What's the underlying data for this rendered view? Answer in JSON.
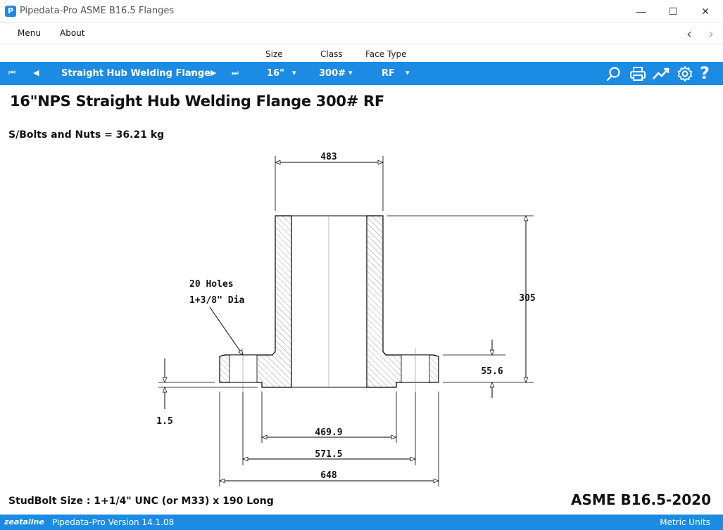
{
  "window": {
    "app_icon": "P",
    "title": "Pipedata-Pro  ASME B16.5 Flanges",
    "minimize": "—",
    "maximize": "☐",
    "close": "✕"
  },
  "menu": {
    "items": [
      "Menu",
      "About"
    ],
    "back": "‹",
    "forward": "›"
  },
  "selector_labels": {
    "size": "Size",
    "class": "Class",
    "face_type": "Face Type"
  },
  "toolbar": {
    "first": "⏮",
    "prev": "◀",
    "flange_type": "Straight Hub Welding Flange",
    "next": "▶",
    "last": "⏭",
    "size": "16\"",
    "class": "300#",
    "face": "RF",
    "dropdown": "▾",
    "icons": [
      "search-icon",
      "print-icon",
      "chart-icon",
      "gear-icon",
      "help-icon"
    ],
    "help_label": "?"
  },
  "content": {
    "heading": "16\"NPS Straight Hub Welding Flange 300# RF",
    "bolts_weight": "S/Bolts and Nuts =  36.21 kg",
    "studbolt": "StudBolt Size : 1+1/4\" UNC  (or M33)  x 190 Long",
    "standard": "ASME B16.5-2020"
  },
  "drawing": {
    "hub_width": "483",
    "length": "305",
    "holes_count": "20 Holes",
    "hole_dia": "1+3/8\" Dia",
    "thickness": "55.6",
    "raised_face": "1.5",
    "raised_face_dia": "469.9",
    "bolt_circle": "571.5",
    "outside_dia": "648"
  },
  "status": {
    "brand": "zeataline",
    "version": "Pipedata-Pro Version 14.1.08",
    "units": "Metric Units"
  },
  "colors": {
    "accent": "#1b8be4",
    "text": "#111111"
  }
}
